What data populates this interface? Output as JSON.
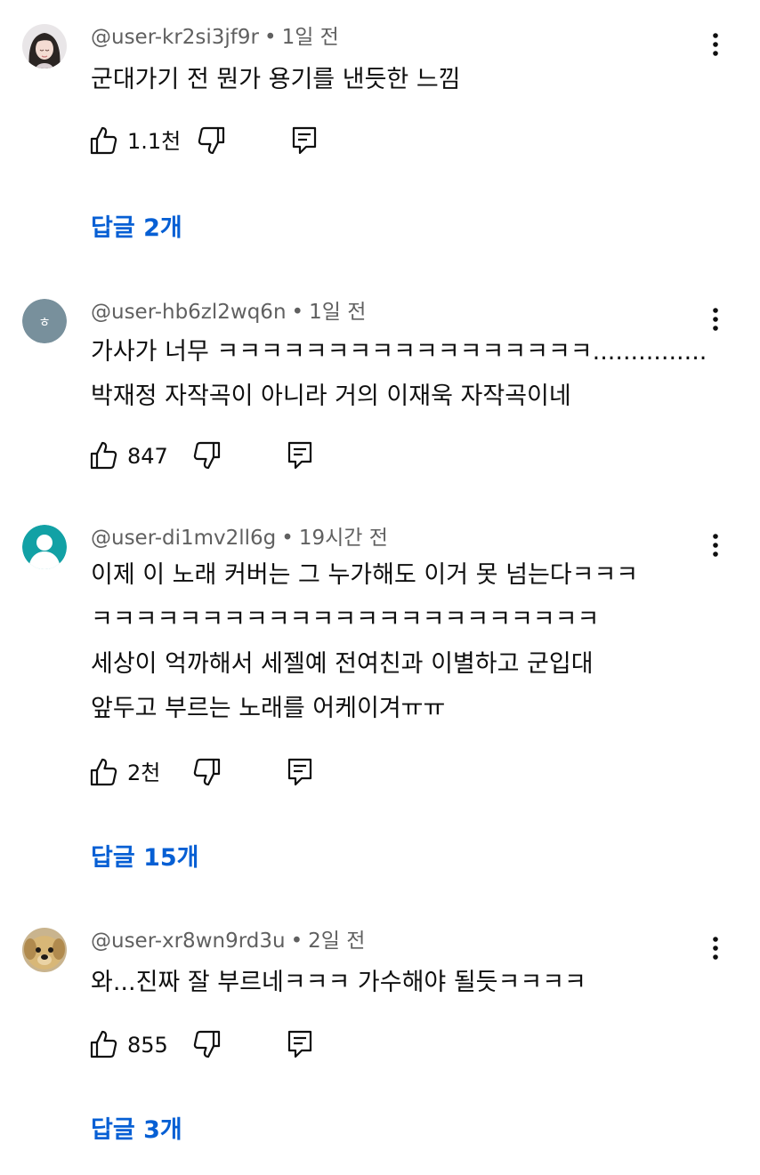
{
  "comments": [
    {
      "handle": "@user-kr2si3jf9r",
      "dot": "•",
      "time": "1일 전",
      "lines": [
        "군대가기 전 뭔가 용기를 낸듯한 느낌"
      ],
      "likes": "1.1천",
      "replies": "답글 2개",
      "avatar": "photo-woman-icon"
    },
    {
      "handle": "@user-hb6zl2wq6n",
      "dot": "•",
      "time": "1일 전",
      "lines": [
        "가사가 너무 ㅋㅋㅋㅋㅋㅋㅋㅋㅋㅋㅋㅋㅋㅋㅋㅋㅋ...............",
        "박재정 자작곡이 아니라 거의 이재욱 자작곡이네"
      ],
      "likes": "847",
      "avatar": "letter-avatar-icon",
      "avatar_letter": "ㅎ",
      "avatar_color": "#78909c"
    },
    {
      "handle": "@user-di1mv2ll6g",
      "dot": "•",
      "time": "19시간 전",
      "lines": [
        "이제 이 노래 커버는 그 누가해도 이거 못 넘는다ㅋㅋㅋ",
        "ㅋㅋㅋㅋㅋㅋㅋㅋㅋㅋㅋㅋㅋㅋㅋㅋㅋㅋㅋㅋㅋㅋㅋ",
        "세상이 억까해서 세젤예 전여친과 이별하고 군입대",
        "앞두고 부르는 노래를 어케이겨ㅠㅠ"
      ],
      "likes": "2천",
      "replies": "답글 15개",
      "avatar": "default-person-icon",
      "avatar_color": "#12a1a5"
    },
    {
      "handle": "@user-xr8wn9rd3u",
      "dot": "•",
      "time": "2일 전",
      "lines": [
        "와...진짜 잘 부르네ㅋㅋㅋ 가수해야 될듯ㅋㅋㅋㅋ"
      ],
      "likes": "855",
      "replies": "답글 3개",
      "avatar": "photo-puppy-icon"
    }
  ],
  "colors": {
    "link": "#065fd4",
    "meta": "#606060",
    "text": "#0f0f0f"
  }
}
